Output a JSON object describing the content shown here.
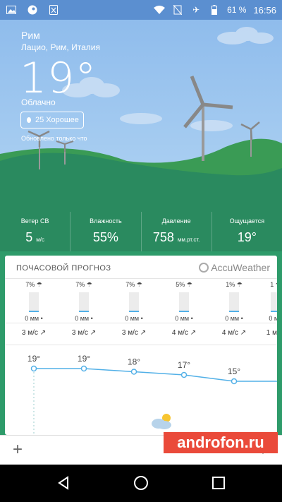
{
  "status_bar": {
    "battery_percent": "61 %",
    "time": "16:56",
    "icons_left": [
      "image-icon",
      "steam-icon",
      "sim-icon"
    ],
    "icons_right": [
      "wifi-icon",
      "no-sim-icon",
      "airplane-icon",
      "battery-icon"
    ]
  },
  "weather": {
    "city": "Рим",
    "region": "Лацио, Рим, Италия",
    "temperature": "19°",
    "condition": "Облачно",
    "air_quality": "25 Хорошее",
    "updated": "Обновлено только что"
  },
  "stats": [
    {
      "label": "Ветер СВ",
      "value": "5",
      "unit": "м/с"
    },
    {
      "label": "Влажность",
      "value": "55%",
      "unit": ""
    },
    {
      "label": "Давление",
      "value": "758",
      "unit": "мм.рт.ст."
    },
    {
      "label": "Ощущается",
      "value": "19°",
      "unit": ""
    }
  ],
  "hourly": {
    "title": "ПОЧАСОВОЙ ПРОГНОЗ",
    "brand": "AccuWeather",
    "columns": [
      {
        "precip_prob": "7%",
        "precip": "0 мм",
        "wind": "3 м/с",
        "temp": "19°"
      },
      {
        "precip_prob": "7%",
        "precip": "0 мм",
        "wind": "3 м/с",
        "temp": "19°"
      },
      {
        "precip_prob": "7%",
        "precip": "0 мм",
        "wind": "3 м/с",
        "temp": "18°"
      },
      {
        "precip_prob": "5%",
        "precip": "0 мм",
        "wind": "4 м/с",
        "temp": "17°"
      },
      {
        "precip_prob": "1%",
        "precip": "0 мм",
        "wind": "4 м/с",
        "temp": "15°"
      },
      {
        "precip_prob": "1",
        "precip": "0 м",
        "wind": "1 м",
        "temp": ""
      }
    ]
  },
  "bottom_bar": {
    "add": "+",
    "menu": "⋮"
  },
  "watermark": "androfon.ru",
  "colors": {
    "status_bar": "#5b8fd0",
    "hill": "#2e9b6a",
    "temp_line": "#52b0e7"
  }
}
